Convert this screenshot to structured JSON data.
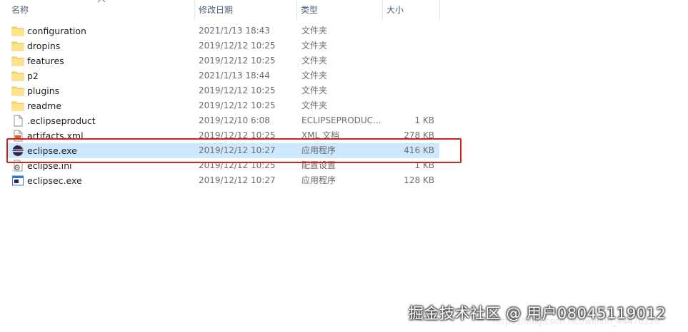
{
  "columns": {
    "name": "名称",
    "date": "修改日期",
    "type": "类型",
    "size": "大小"
  },
  "files": [
    {
      "name": "configuration",
      "date": "2021/1/13 18:43",
      "type": "文件夹",
      "size": "",
      "icon": "folder-icon"
    },
    {
      "name": "dropins",
      "date": "2019/12/12 10:25",
      "type": "文件夹",
      "size": "",
      "icon": "folder-icon"
    },
    {
      "name": "features",
      "date": "2019/12/12 10:25",
      "type": "文件夹",
      "size": "",
      "icon": "folder-icon"
    },
    {
      "name": "p2",
      "date": "2021/1/13 18:44",
      "type": "文件夹",
      "size": "",
      "icon": "folder-icon"
    },
    {
      "name": "plugins",
      "date": "2019/12/12 10:25",
      "type": "文件夹",
      "size": "",
      "icon": "folder-icon"
    },
    {
      "name": "readme",
      "date": "2019/12/12 10:25",
      "type": "文件夹",
      "size": "",
      "icon": "folder-icon"
    },
    {
      "name": ".eclipseproduct",
      "date": "2019/12/10 6:08",
      "type": "ECLIPSEPRODUC...",
      "size": "1 KB",
      "icon": "file-icon"
    },
    {
      "name": "artifacts.xml",
      "date": "2019/12/12 10:25",
      "type": "XML 文档",
      "size": "278 KB",
      "icon": "xml-file-icon"
    },
    {
      "name": "eclipse.exe",
      "date": "2019/12/12 10:27",
      "type": "应用程序",
      "size": "416 KB",
      "icon": "eclipse-icon",
      "selected": true
    },
    {
      "name": "eclipse.ini",
      "date": "2019/12/12 10:25",
      "type": "配置设置",
      "size": "1 KB",
      "icon": "ini-file-icon"
    },
    {
      "name": "eclipsec.exe",
      "date": "2019/12/12 10:27",
      "type": "应用程序",
      "size": "128 KB",
      "icon": "exe-icon"
    }
  ],
  "colors": {
    "selection": "#cce8ff",
    "highlight_border": "#d0221f",
    "folder": "#ffd866"
  },
  "watermark": {
    "main": "掘金技术社区 @ 用户08045119012",
    "faint": "https://blog.csdn.net/weixin_44470220"
  }
}
